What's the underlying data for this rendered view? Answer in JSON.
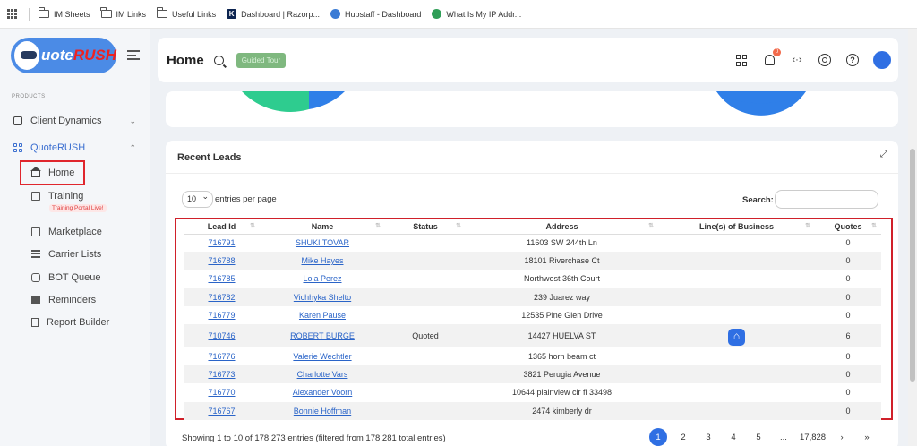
{
  "bookmarks": [
    {
      "label": "IM Sheets",
      "icon": "folder-icon"
    },
    {
      "label": "IM Links",
      "icon": "folder-icon"
    },
    {
      "label": "Useful Links",
      "icon": "folder-icon"
    },
    {
      "label": "Dashboard | Razorp...",
      "icon": "razorpay-icon"
    },
    {
      "label": "Hubstaff - Dashboard",
      "icon": "hubstaff-icon"
    },
    {
      "label": "What Is My IP Addr...",
      "icon": "globe-icon"
    }
  ],
  "sidebar": {
    "logo": {
      "prefix": "uote",
      "highlight": "RUSH"
    },
    "section_label": "PRODUCTS",
    "client_dynamics": "Client Dynamics",
    "quoterush": "QuoteRUSH",
    "items": [
      {
        "label": "Home"
      },
      {
        "label": "Training",
        "tag": "Training Portal Live!"
      },
      {
        "label": "Marketplace"
      },
      {
        "label": "Carrier Lists"
      },
      {
        "label": "BOT Queue"
      },
      {
        "label": "Reminders"
      },
      {
        "label": "Report Builder"
      }
    ]
  },
  "header": {
    "title": "Home",
    "guided_tour": "Guided Tour",
    "notification_count": "0"
  },
  "leads": {
    "title": "Recent Leads",
    "entries_value": "10",
    "entries_suffix": "entries per page",
    "search_label": "Search:",
    "columns": [
      "Lead Id",
      "Name",
      "Status",
      "Address",
      "Line(s) of Business",
      "Quotes"
    ],
    "rows": [
      {
        "id": "716791",
        "name": "SHUKI TOVAR",
        "status": "",
        "address": "11603 SW 244th Ln",
        "quotes": "0"
      },
      {
        "id": "716788",
        "name": "Mike Hayes",
        "status": "",
        "address": "18101 Riverchase Ct",
        "quotes": "0"
      },
      {
        "id": "716785",
        "name": "Lola Perez",
        "status": "",
        "address": "Northwest 36th Court",
        "quotes": "0"
      },
      {
        "id": "716782",
        "name": "Vichhyka Shelto",
        "status": "",
        "address": "239 Juarez way",
        "quotes": "0"
      },
      {
        "id": "716779",
        "name": "Karen Pause",
        "status": "",
        "address": "12535 Pine Glen Drive",
        "quotes": "0"
      },
      {
        "id": "710746",
        "name": "ROBERT BURGE",
        "status": "Quoted",
        "address": "14427 HUELVA ST",
        "quotes": "6"
      },
      {
        "id": "716776",
        "name": "Valerie Wechtler",
        "status": "",
        "address": "1365 horn beam ct",
        "quotes": "0"
      },
      {
        "id": "716773",
        "name": "Charlotte Vars",
        "status": "",
        "address": "3821 Perugia Avenue",
        "quotes": "0"
      },
      {
        "id": "716770",
        "name": "Alexander Voorn",
        "status": "",
        "address": "10644 plainview cir fl 33498",
        "quotes": "0"
      },
      {
        "id": "716767",
        "name": "Bonnie Hoffman",
        "status": "",
        "address": "2474 kimberly dr",
        "quotes": "0"
      }
    ],
    "showing": "Showing 1 to 10 of 178,273 entries (filtered from 178,281 total entries)",
    "pages": [
      "1",
      "2",
      "3",
      "4",
      "5",
      "...",
      "17,828",
      "›",
      "»"
    ]
  }
}
